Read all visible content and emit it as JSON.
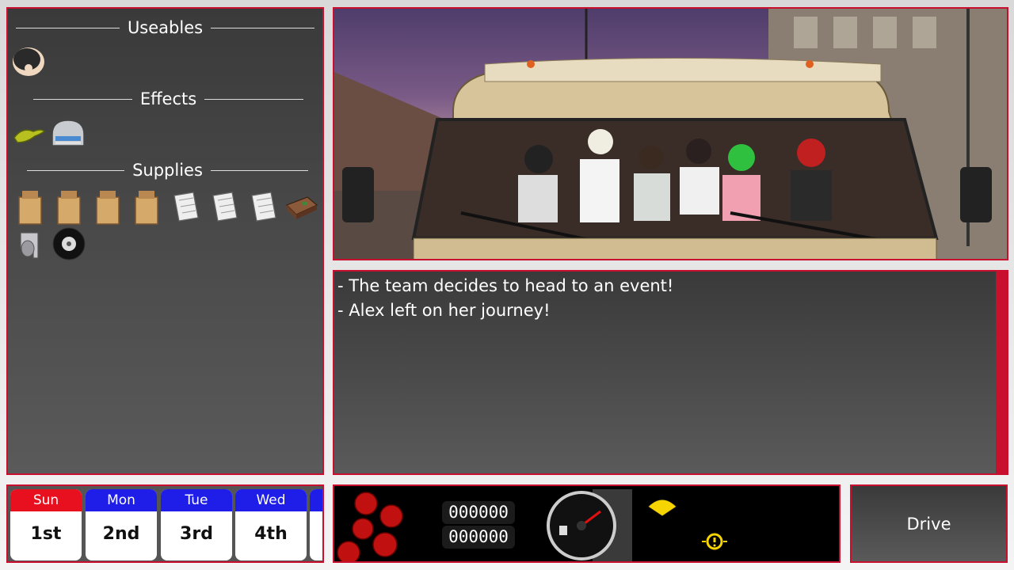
{
  "inventory": {
    "useables_title": "Useables",
    "effects_title": "Effects",
    "supplies_title": "Supplies",
    "useables": [
      "mask-item-icon"
    ],
    "effects": [
      "lizard-effect-icon",
      "helmet-effect-icon"
    ],
    "supplies": [
      "grocery-bag-icon",
      "grocery-bag-icon",
      "grocery-bag-icon",
      "grocery-bag-icon",
      "newspaper-icon",
      "newspaper-icon",
      "newspaper-icon",
      "toolbox-icon",
      "duct-tape-icon",
      "tire-icon"
    ]
  },
  "log": {
    "lines": [
      "- The team decides to head to an event!",
      "- Alex left on her journey!"
    ]
  },
  "calendar": {
    "days": [
      {
        "name": "Sun",
        "date": "1st",
        "color": "#e8101e"
      },
      {
        "name": "Mon",
        "date": "2nd",
        "color": "#1e1ee8"
      },
      {
        "name": "Tue",
        "date": "3rd",
        "color": "#1e1ee8"
      },
      {
        "name": "Wed",
        "date": "4th",
        "color": "#1e1ee8"
      }
    ]
  },
  "dashboard": {
    "odometer_top": "000000",
    "odometer_bottom": "000000",
    "fuel_gauge_icon": "fuel-gauge-icon",
    "wiper_warning_icon": "wiper-warning-icon",
    "engine_warning_icon": "engine-warning-icon"
  },
  "drive_button_label": "Drive",
  "colors": {
    "accent": "#c8102e",
    "sun": "#e8101e",
    "weekday": "#1e1ee8",
    "warning": "#f5d400"
  }
}
